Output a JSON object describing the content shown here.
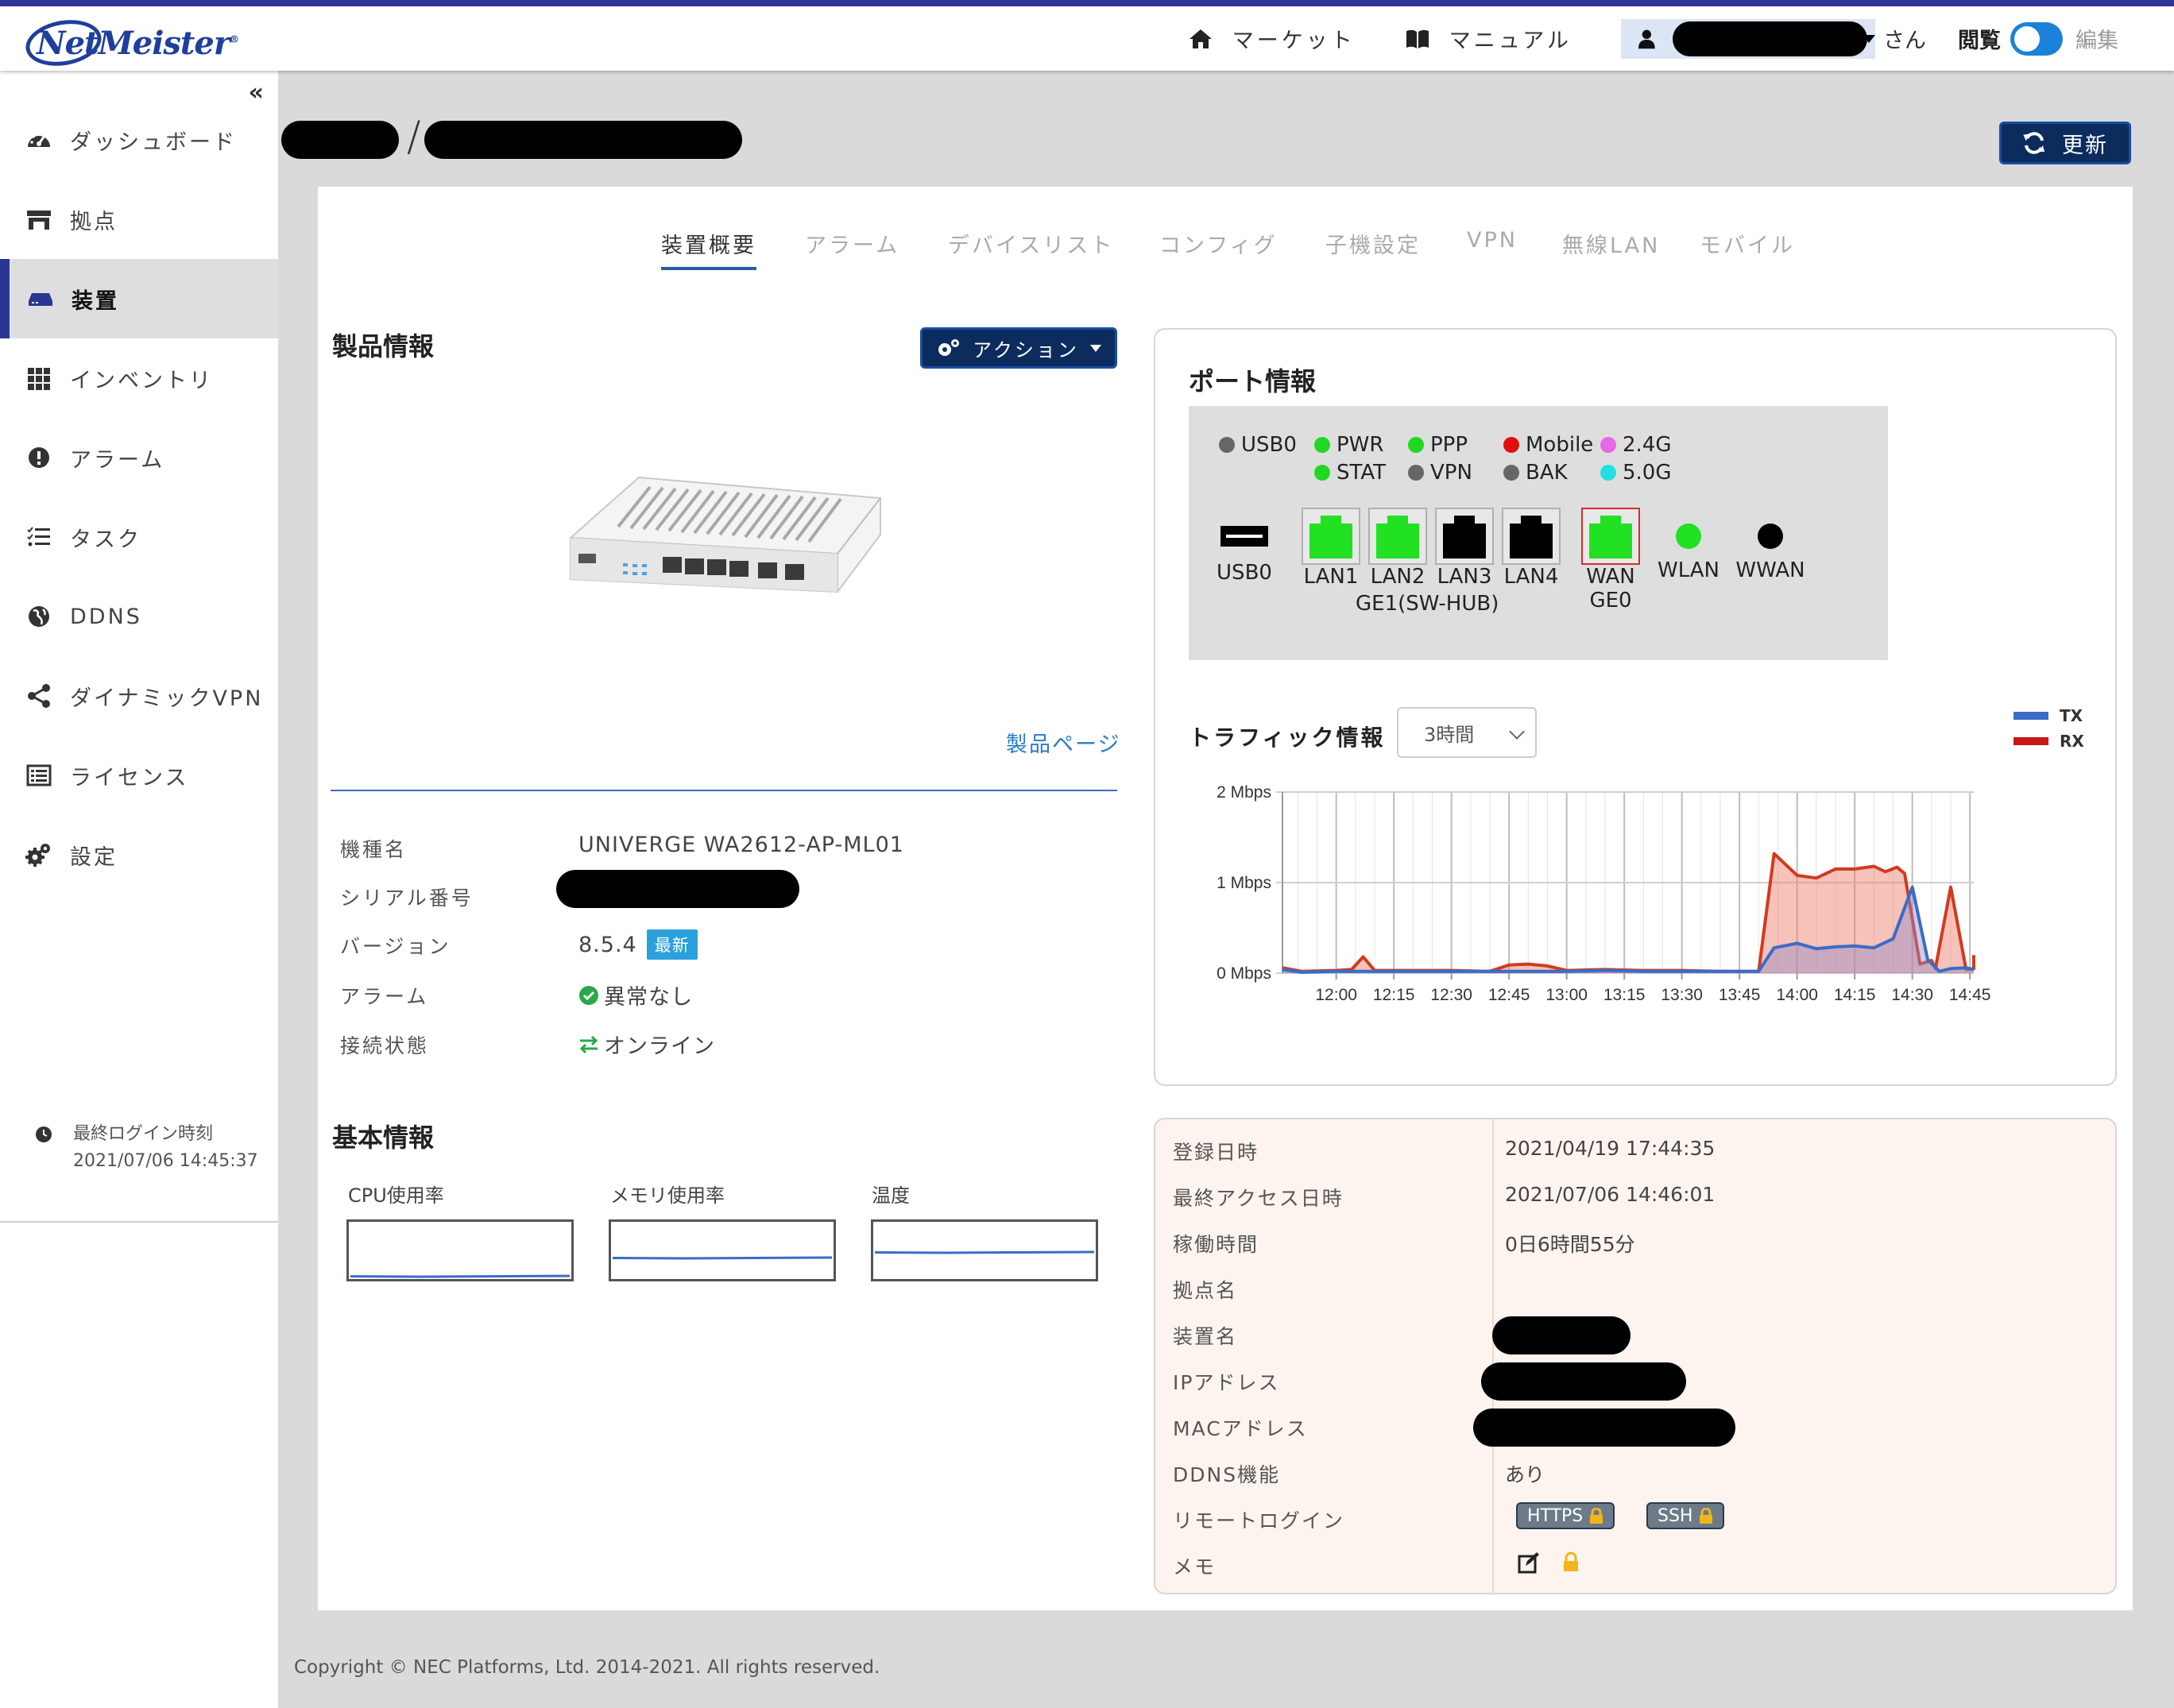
{
  "app": {
    "logo_text": "NetMeister"
  },
  "top_nav": {
    "market_label": "マーケット",
    "manual_label": "マニュアル",
    "user_suffix": "さん",
    "mode_view": "閲覧",
    "mode_edit": "編集"
  },
  "sidebar": {
    "collapse_glyph": "«",
    "items": [
      {
        "label": "ダッシュボード",
        "icon": "dashboard-icon"
      },
      {
        "label": "拠点",
        "icon": "store-icon"
      },
      {
        "label": "装置",
        "icon": "device-icon"
      },
      {
        "label": "インベントリ",
        "icon": "grid-icon"
      },
      {
        "label": "アラーム",
        "icon": "alert-icon"
      },
      {
        "label": "タスク",
        "icon": "tasks-icon"
      },
      {
        "label": "DDNS",
        "icon": "globe-icon"
      },
      {
        "label": "ダイナミックVPN",
        "icon": "share-icon"
      },
      {
        "label": "ライセンス",
        "icon": "license-icon"
      },
      {
        "label": "設定",
        "icon": "gears-icon"
      }
    ],
    "active_index": 2,
    "last_login_label": "最終ログイン時刻",
    "last_login_value": "2021/07/06 14:45:37"
  },
  "header": {
    "refresh_label": "更新"
  },
  "tabs": [
    "装置概要",
    "アラーム",
    "デバイスリスト",
    "コンフィグ",
    "子機設定",
    "VPN",
    "無線LAN",
    "モバイル"
  ],
  "product": {
    "section_title": "製品情報",
    "action_label": "アクション",
    "product_page_link": "製品ページ",
    "rows": [
      {
        "label": "機種名",
        "value": "UNIVERGE WA2612-AP-ML01"
      },
      {
        "label": "シリアル番号",
        "value": ""
      },
      {
        "label": "バージョン",
        "value": "8.5.4",
        "badge": "最新"
      },
      {
        "label": "アラーム",
        "value": "異常なし"
      },
      {
        "label": "接続状態",
        "value": "オンライン"
      }
    ]
  },
  "basic": {
    "section_title": "基本情報",
    "gauges": [
      {
        "label": "CPU使用率",
        "level": 0.02
      },
      {
        "label": "メモリ使用率",
        "level": 0.35
      },
      {
        "label": "温度",
        "level": 0.45
      }
    ]
  },
  "ports": {
    "title": "ポート情報",
    "leds": [
      {
        "label": "USB0",
        "color": "#666666"
      },
      {
        "label": "PWR",
        "color": "#22d822"
      },
      {
        "label": "PPP",
        "color": "#22d822"
      },
      {
        "label": "Mobile",
        "color": "#e01010"
      },
      {
        "label": "2.4G",
        "color": "#e868e8"
      },
      {
        "label": "STAT",
        "color": "#22d822"
      },
      {
        "label": "VPN",
        "color": "#666666"
      },
      {
        "label": "BAK",
        "color": "#666666"
      },
      {
        "label": "5.0G",
        "color": "#22e0e0"
      }
    ],
    "port_labels": [
      "USB0",
      "LAN1",
      "LAN2",
      "LAN3",
      "LAN4",
      "WAN",
      "WLAN",
      "WWAN"
    ],
    "lan_group_label": "GE1(SW-HUB)",
    "wan_sub_label": "GE0"
  },
  "traffic": {
    "title": "トラフィック情報",
    "range_selected": "3時間",
    "legend_tx": "TX",
    "legend_rx": "RX",
    "tx_color": "#3a6cc8",
    "rx_color": "#d23a1e"
  },
  "chart_data": {
    "type": "area",
    "title": "",
    "xlabel": "",
    "ylabel": "",
    "y_ticks": [
      "2 Mbps",
      "1 Mbps",
      "0 Mbps"
    ],
    "ylim": [
      0,
      2
    ],
    "x_ticks": [
      "12:00",
      "12:15",
      "12:30",
      "12:45",
      "13:00",
      "13:15",
      "13:30",
      "13:45",
      "14:00",
      "14:15",
      "14:30",
      "14:45"
    ],
    "x_start_minutes": 706,
    "x_end_minutes": 886,
    "series": [
      {
        "name": "TX",
        "points": [
          [
            706,
            0.04
          ],
          [
            711,
            0.01
          ],
          [
            720,
            0.02
          ],
          [
            730,
            0.02
          ],
          [
            740,
            0.02
          ],
          [
            750,
            0.02
          ],
          [
            760,
            0.02
          ],
          [
            770,
            0.02
          ],
          [
            780,
            0.02
          ],
          [
            790,
            0.03
          ],
          [
            800,
            0.02
          ],
          [
            810,
            0.02
          ],
          [
            820,
            0.02
          ],
          [
            830,
            0.02
          ],
          [
            834,
            0.28
          ],
          [
            840,
            0.33
          ],
          [
            845,
            0.27
          ],
          [
            850,
            0.29
          ],
          [
            855,
            0.3
          ],
          [
            860,
            0.28
          ],
          [
            865,
            0.38
          ],
          [
            870,
            0.95
          ],
          [
            874,
            0.15
          ],
          [
            877,
            0.02
          ],
          [
            880,
            0.05
          ],
          [
            884,
            0.06
          ],
          [
            886,
            0.04
          ]
        ]
      },
      {
        "name": "RX",
        "points": [
          [
            706,
            0.06
          ],
          [
            711,
            0.02
          ],
          [
            720,
            0.03
          ],
          [
            724,
            0.04
          ],
          [
            727,
            0.18
          ],
          [
            730,
            0.03
          ],
          [
            740,
            0.03
          ],
          [
            750,
            0.03
          ],
          [
            760,
            0.02
          ],
          [
            765,
            0.09
          ],
          [
            770,
            0.1
          ],
          [
            775,
            0.08
          ],
          [
            780,
            0.03
          ],
          [
            790,
            0.04
          ],
          [
            800,
            0.03
          ],
          [
            810,
            0.03
          ],
          [
            820,
            0.02
          ],
          [
            830,
            0.02
          ],
          [
            834,
            1.32
          ],
          [
            840,
            1.08
          ],
          [
            845,
            1.05
          ],
          [
            850,
            1.15
          ],
          [
            855,
            1.15
          ],
          [
            860,
            1.18
          ],
          [
            863,
            1.12
          ],
          [
            866,
            1.17
          ],
          [
            868,
            1.1
          ],
          [
            872,
            0.1
          ],
          [
            875,
            0.14
          ],
          [
            876,
            0.05
          ],
          [
            880,
            0.95
          ],
          [
            884,
            0.04
          ],
          [
            886,
            0.05
          ],
          [
            890,
            0.2
          ]
        ]
      }
    ]
  },
  "details": {
    "rows": [
      {
        "label": "登録日時",
        "value": "2021/04/19 17:44:35"
      },
      {
        "label": "最終アクセス日時",
        "value": "2021/07/06 14:46:01"
      },
      {
        "label": "稼働時間",
        "value": "0日6時間55分"
      },
      {
        "label": "拠点名",
        "value": ""
      },
      {
        "label": "装置名",
        "value": ""
      },
      {
        "label": "IPアドレス",
        "value": ""
      },
      {
        "label": "MACアドレス",
        "value": ""
      },
      {
        "label": "DDNS機能",
        "value": "あり"
      },
      {
        "label": "リモートログイン",
        "value": ""
      },
      {
        "label": "メモ",
        "value": ""
      }
    ],
    "remote_https": "HTTPS",
    "remote_ssh": "SSH"
  },
  "footer": {
    "copyright": "Copyright © NEC Platforms, Ltd. 2014-2021. All rights reserved."
  }
}
